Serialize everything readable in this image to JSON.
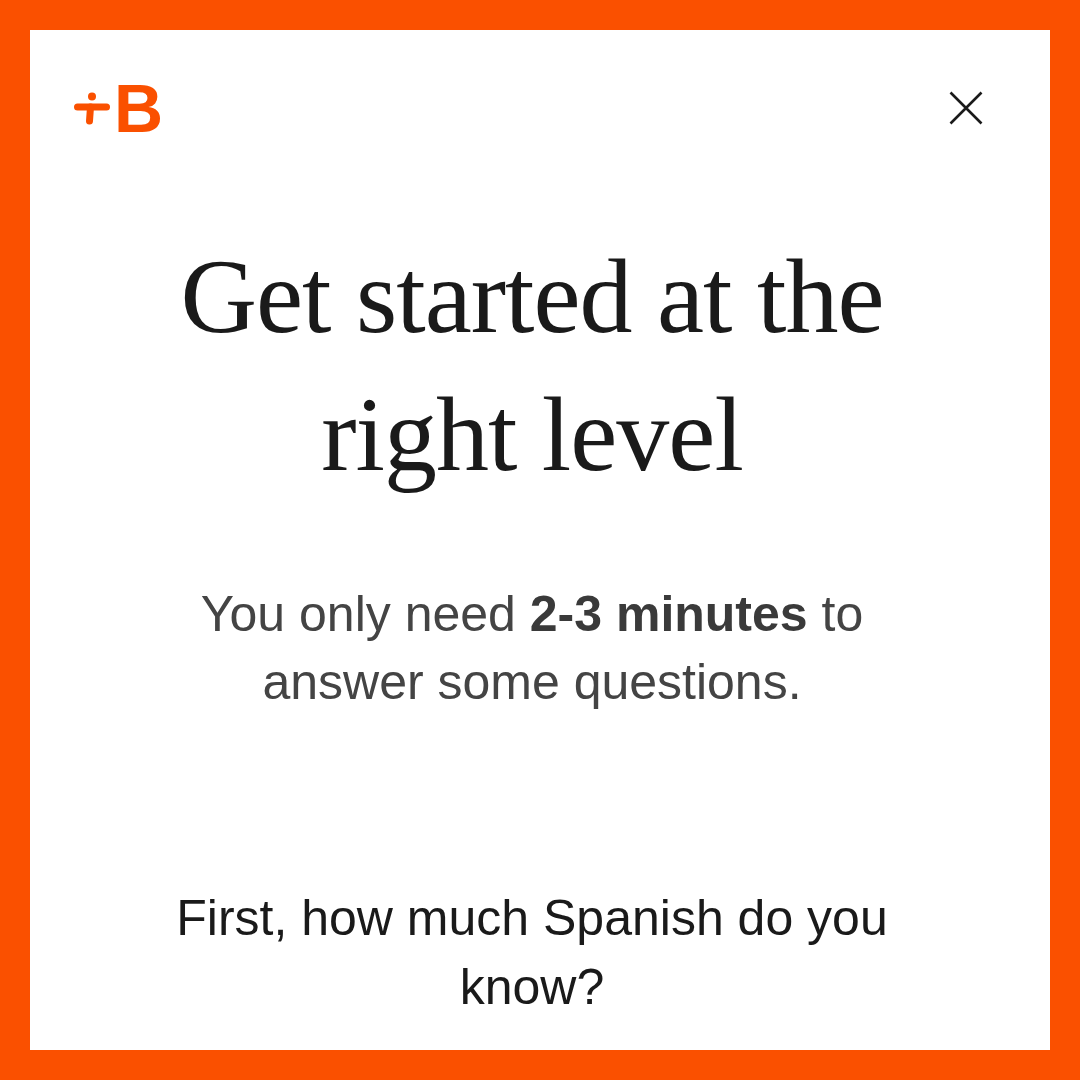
{
  "brand": {
    "logo_text": "B"
  },
  "title": "Get started at the right level",
  "subtitle": "You only need **2-3 minutes** to answer some questions.",
  "question": "First, how much Spanish do you know?"
}
